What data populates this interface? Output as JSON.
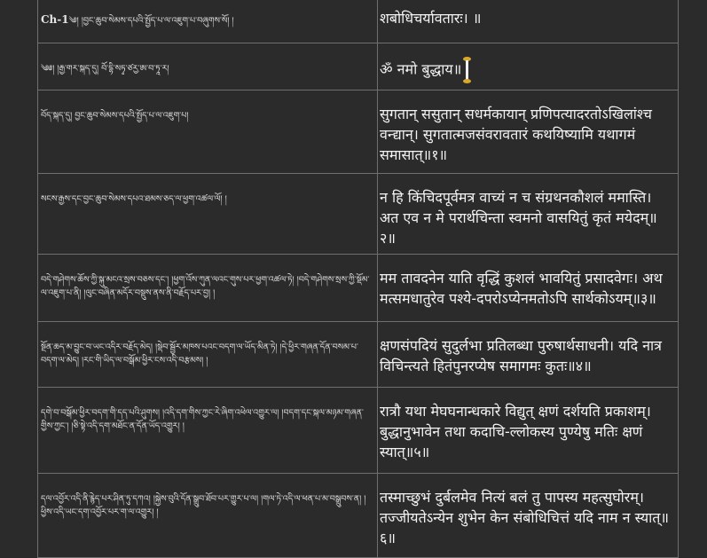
{
  "rows": [
    {
      "chapter": "Ch-1",
      "tibetan": "༄། །བྱང་ཆུབ་སེམས་དཔའི་སྤྱོད་པ་ལ་འཇུག་པ་བཞུགས་སོ། །",
      "sanskrit": "शबोधिचर्यावतारः। ॥"
    },
    {
      "chapter": "",
      "tibetan": "༄༅། །རྒྱ་གར་སྐད་དུ། བོ་དྷི་སཏྭ་ཙརྱ་ཨ་བ་ཏཱ་ར།",
      "sanskrit": "ॐ नमो बुद्धाय॥"
    },
    {
      "chapter": "",
      "tibetan": "བོད་སྐད་དུ། བྱང་ཆུབ་སེམས་དཔའི་སྤྱོད་པ་ལ་འཇུག་པ།",
      "sanskrit": "सुगतान् ससुतान् सधर्मकायान् प्रणिपत्यादरतोऽखिलांश्च वन्द्यान्। सुगतात्मजसंवरावतारं कथयिष्यामि यथागमं समासात्॥१॥"
    },
    {
      "chapter": "",
      "tibetan": "སངས་རྒྱས་དང་བྱང་ཆུབ་སེམས་དཔའ་ཐམས་ཅད་ལ་ཕྱག་འཚལ་ལོ། །",
      "sanskrit": "न हि किंचिदपूर्वमत्र वाच्यं न च संग्रथनकौशलं ममास्ति। अत एव न मे परार्थचिन्ता स्वमनो वासयितुं कृतं मयेदम्॥२॥"
    },
    {
      "chapter": "",
      "tibetan": "བདེ་གཤེགས་ཆོས་ཀྱི་སྐུ་མངའ་སྲས་བཅས་དང་། །ཕྱག་འོས་ཀུན་ལའང་གུས་པར་ཕྱག་འཚལ་ཏེ། །བདེ་གཤེགས་སྲས་ཀྱི་སྡོམ་ལ་འཇུག་པ་ནི། །ལུང་བཞིན་མདོར་བསྡུས་ནས་ནི་བརྗོད་པར་བྱ། །",
      "sanskrit": "मम तावदनेन याति वृद्धिं कुशलं भावयितुं प्रसादवेगः। अथ मत्समधातुरेव पश्ये-दपरोऽप्येनमतोऽपि सार्थकोऽयम्॥३॥"
    },
    {
      "chapter": "",
      "tibetan": "སྔོན་ཆད་མ་བྱུང་བ་ཡང་འདིར་བརྗོད་མེད། །སྡེབ་སྦྱོར་མཁས་པའང་བདག་ལ་ཡོད་མིན་ཏེ། །དེ་ཕྱིར་གཞན་དོན་བསམ་པ་བདག་ལ་མེད། །རང་གི་ཡིད་ལ་བསྒོམ་ཕྱིར་ངས་འདི་བརྩམས། །",
      "sanskrit": "क्षणसंपदियं सुदुर्लभा प्रतिलब्धा पुरुषार्थसाधनी। यदि नात्र विचिन्त्यते हितंपुनरप्येष समागमः कुतः॥४॥"
    },
    {
      "chapter": "",
      "tibetan": "དགེ་བ་བསྒོམ་ཕྱིར་བདག་གི་དད་པའི་ཤུགས། །འདི་དག་གིས་ཀྱང་རེ་ཞིག་འཕེལ་འགྱུར་ལ། །བདག་དང་སྐལ་མཉམ་གཞན་གྱིས་ཀྱང་། །ཅི་སྟེ་འདི་དག་མཐོང་ན་དོན་ཡོད་འགྱུར། །",
      "sanskrit": "रात्रौ यथा मेघघनान्धकारे विद्युत् क्षणं दर्शयति प्रकाशम्। बुद्धानुभावेन तथा कदाचि-ल्लोकस्य पुण्येषु मतिः क्षणं स्यात्॥५॥"
    },
    {
      "chapter": "",
      "tibetan": "དལ་འབྱོར་འདི་ནི་རྙེད་པར་ཤིན་ཏུ་དཀའ། །སྐྱེས་བུའི་དོན་སྒྲུབ་ཐོབ་པར་གྱུར་པ་ལ། །གལ་ཏེ་འདི་ལ་ཕན་པ་མ་བསྒྲུབས་ན། །ཕྱིས་འདི་ཡང་དག་འབྱོར་པར་ག་ལ་འགྱུར། །",
      "sanskrit": "तस्माच्छुभं दुर्बलमेव नित्यं बलं तु पापस्य महत्सुघोरम्। तज्जीयतेऽन्येन शुभेन केन संबोधिचित्तं यदि नाम न स्यात्॥६॥"
    }
  ],
  "colors": {
    "background": "#2b2b2b",
    "border": "#6f6f6f",
    "text": "#ececec",
    "cursor_cap": "#d9a92a"
  }
}
